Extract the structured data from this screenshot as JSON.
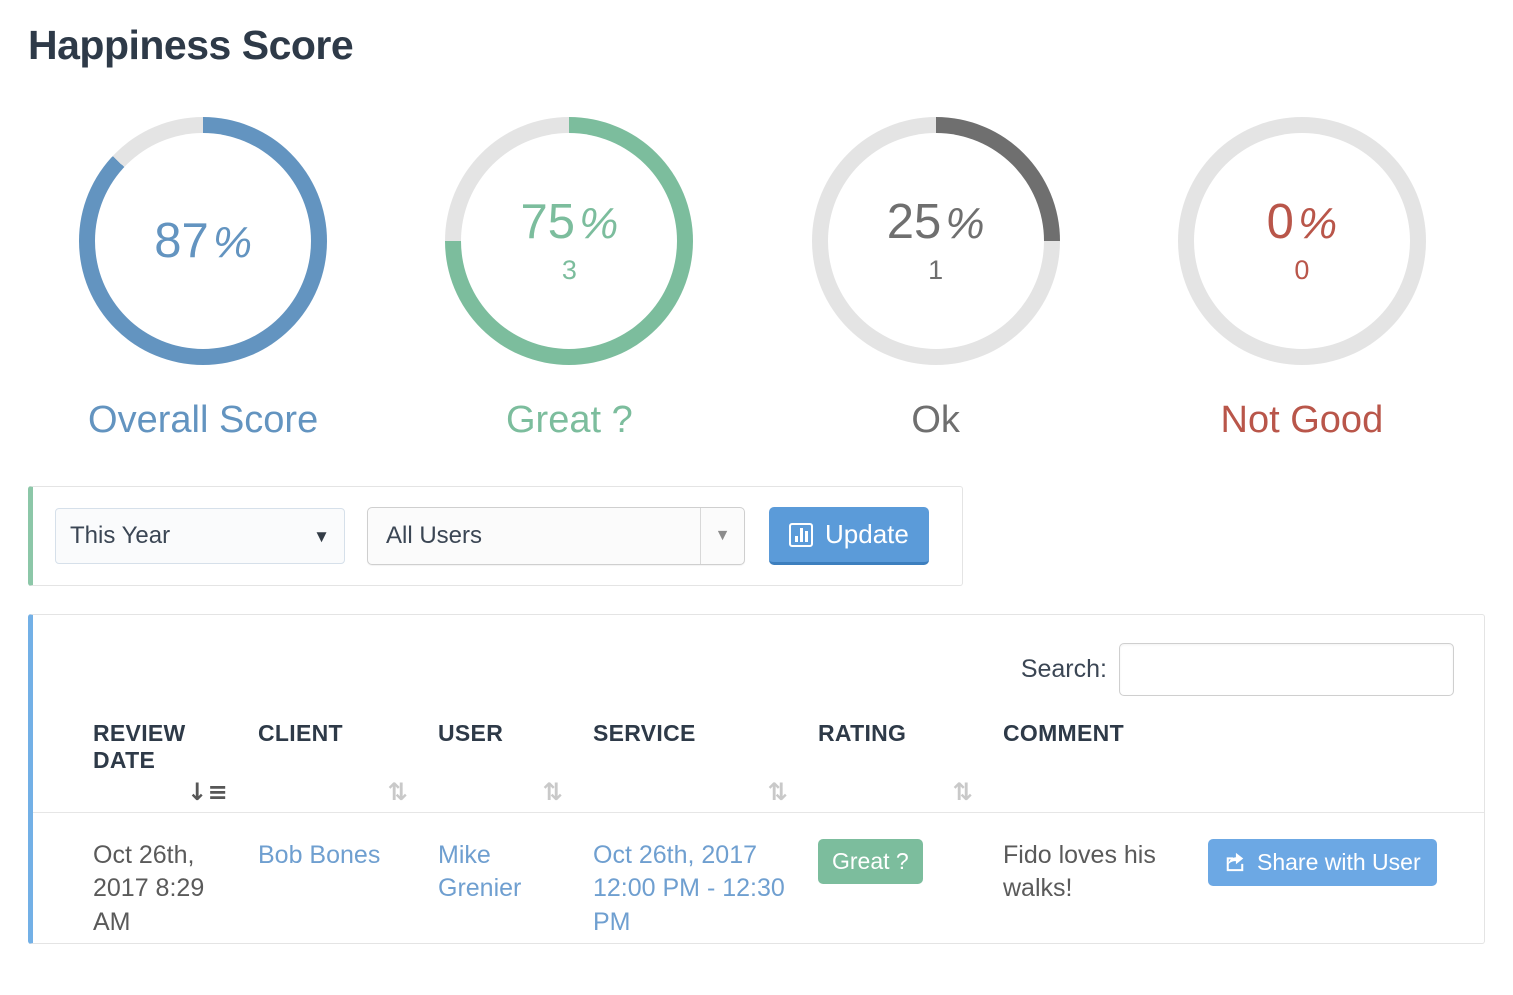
{
  "page": {
    "title": "Happiness Score"
  },
  "colors": {
    "blue": "#6394c0",
    "green": "#7cbd9d",
    "gray": "#6f6f6f",
    "red": "#b9564a",
    "track": "#e4e4e4",
    "link": "#6f9fd0",
    "button_blue": "#5b9bd9",
    "panel_green_border": "#8cc7a8",
    "panel_blue_border": "#73b0e6"
  },
  "chart_data": {
    "type": "pie",
    "title": "Happiness Score",
    "charts": [
      {
        "label": "Overall Score",
        "percent": 87,
        "percent_text": "87",
        "symbol": "%",
        "count": null,
        "color": "#6394c0",
        "track": "#e4e4e4"
      },
      {
        "label": "Great ?",
        "percent": 75,
        "percent_text": "75",
        "symbol": "%",
        "count": "3",
        "color": "#7cbd9d",
        "track": "#e4e4e4"
      },
      {
        "label": "Ok",
        "percent": 25,
        "percent_text": "25",
        "symbol": "%",
        "count": "1",
        "color": "#6f6f6f",
        "track": "#e4e4e4"
      },
      {
        "label": "Not Good",
        "percent": 0,
        "percent_text": "0",
        "symbol": "%",
        "count": "0",
        "color": "#b9564a",
        "track": "#e4e4e4"
      }
    ]
  },
  "filters": {
    "period": {
      "value": "This Year",
      "caret": "▼"
    },
    "user": {
      "value": "All Users",
      "caret": "▼"
    },
    "update_button": {
      "label": "Update",
      "icon": "bar-chart-icon"
    }
  },
  "table": {
    "search": {
      "label": "Search:",
      "value": "",
      "placeholder": ""
    },
    "columns": [
      {
        "key": "review_date",
        "label": "REVIEW DATE",
        "sortable": true,
        "sorted": "desc",
        "icon": "sort-desc-icon"
      },
      {
        "key": "client",
        "label": "CLIENT",
        "sortable": true,
        "sorted": "none",
        "icon": "sort-icon"
      },
      {
        "key": "user",
        "label": "USER",
        "sortable": true,
        "sorted": "none",
        "icon": "sort-icon"
      },
      {
        "key": "service",
        "label": "SERVICE",
        "sortable": true,
        "sorted": "none",
        "icon": "sort-icon"
      },
      {
        "key": "rating",
        "label": "RATING",
        "sortable": true,
        "sorted": "none",
        "icon": "sort-icon"
      },
      {
        "key": "comment",
        "label": "COMMENT",
        "sortable": false,
        "sorted": "none",
        "icon": ""
      }
    ],
    "rows": [
      {
        "review_date": "Oct 26th, 2017 8:29 AM",
        "client": "Bob Bones",
        "user": "Mike Grenier",
        "service": "Oct 26th, 2017 12:00 PM - 12:30 PM",
        "rating": "Great ?",
        "comment": "Fido loves his walks!",
        "action": "Share with User"
      }
    ]
  }
}
